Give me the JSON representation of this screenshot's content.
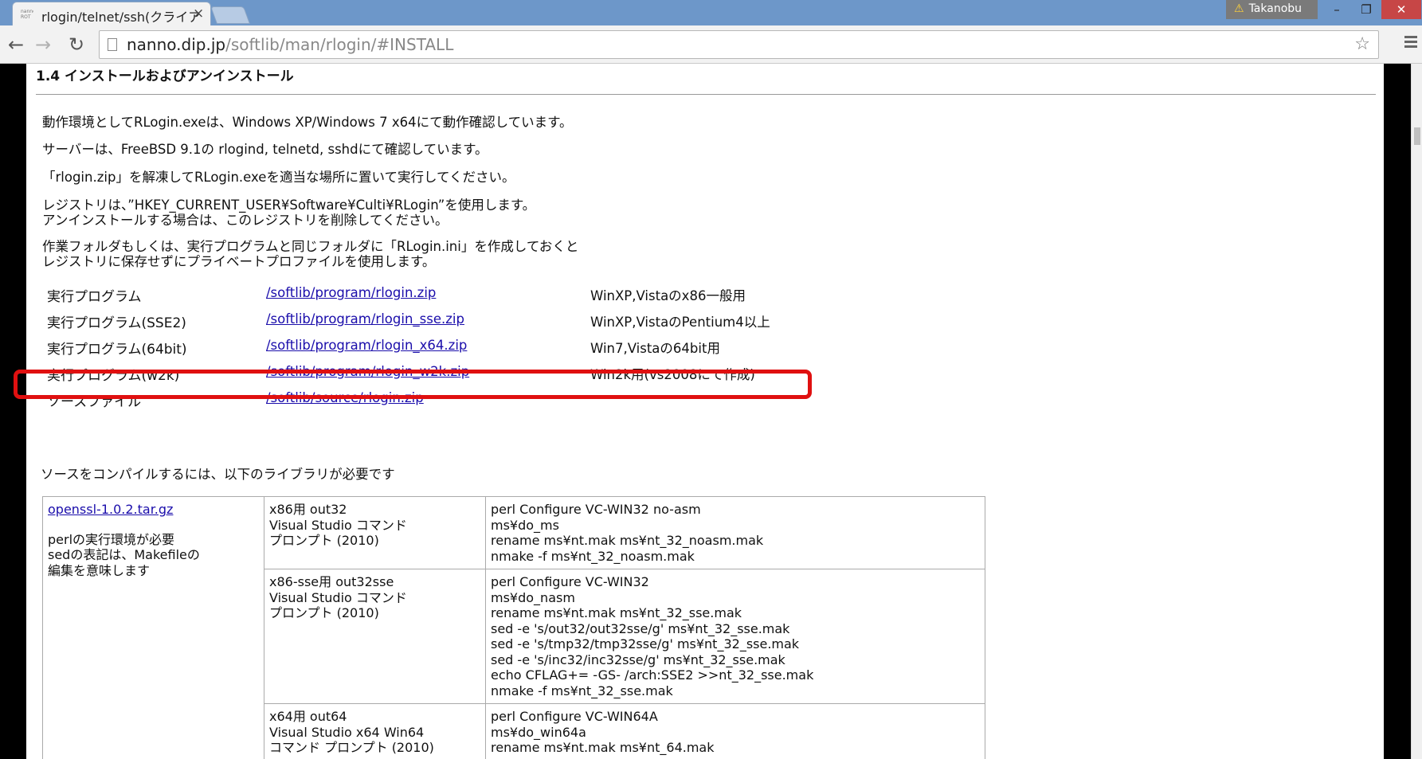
{
  "browser": {
    "tab_title": "rlogin/telnet/ssh(クライア",
    "tab_favicon": "nanno ROT",
    "tab_close": "×",
    "profile_name": "Takanobu",
    "url_host": "nanno.dip.jp",
    "url_path": "/softlib/man/rlogin/#INSTALL",
    "back": "←",
    "forward": "→",
    "reload": "↻",
    "star": "☆",
    "win_min": "–",
    "win_max": "❐",
    "win_close": "✕"
  },
  "page": {
    "section_title": "1.4 インストールおよびアンインストール",
    "paragraphs": [
      "動作環境としてRLogin.exeは、Windows XP/Windows 7 x64にて動作確認しています。",
      "サーバーは、FreeBSD 9.1の rlogind, telnetd, sshdにて確認しています。",
      "「rlogin.zip」を解凍してRLogin.exeを適当な場所に置いて実行してください。",
      "レジストリは、”HKEY_CURRENT_USER¥Software¥Culti¥RLogin”を使用します。\nアンインストールする場合は、このレジストリを削除してください。",
      "作業フォルダもしくは、実行プログラムと同じフォルダに「RLogin.ini」を作成しておくと\nレジストリに保存せずにプライベートプロファイルを使用します。"
    ],
    "downloads": [
      {
        "name": "実行プログラム",
        "link": "/softlib/program/rlogin.zip",
        "note": "WinXP,Vistaのx86一般用"
      },
      {
        "name": "実行プログラム(SSE2)",
        "link": "/softlib/program/rlogin_sse.zip",
        "note": "WinXP,VistaのPentium4以上"
      },
      {
        "name": "実行プログラム(64bit)",
        "link": "/softlib/program/rlogin_x64.zip",
        "note": "Win7,Vistaの64bit用"
      },
      {
        "name": "実行プログラム(w2k)",
        "link": "/softlib/program/rlogin_w2k.zip",
        "note": "Win2k用(vs2008にて作成)"
      },
      {
        "name": "ソースファイル",
        "link": "/softlib/source/rlogin.zip",
        "note": ""
      }
    ],
    "compile_note": "ソースをコンパイルするには、以下のライブラリが必要です",
    "lib": {
      "link": "openssl-1.0.2.tar.gz",
      "desc": "perlの実行環境が必要\nsedの表記は、Makefileの\n編集を意味します",
      "rows": [
        {
          "target": "x86用 out32\nVisual Studio コマンド\nプロンプト (2010)",
          "cmds": "perl Configure VC-WIN32 no-asm\nms¥do_ms\nrename ms¥nt.mak ms¥nt_32_noasm.mak\nnmake -f ms¥nt_32_noasm.mak"
        },
        {
          "target": "x86-sse用 out32sse\nVisual Studio コマンド\nプロンプト (2010)",
          "cmds": "perl Configure VC-WIN32\nms¥do_nasm\nrename ms¥nt.mak ms¥nt_32_sse.mak\nsed -e 's/out32/out32sse/g' ms¥nt_32_sse.mak\nsed -e 's/tmp32/tmp32sse/g' ms¥nt_32_sse.mak\nsed -e 's/inc32/inc32sse/g' ms¥nt_32_sse.mak\necho CFLAG+= -GS- /arch:SSE2 >>nt_32_sse.mak\nnmake -f ms¥nt_32_sse.mak"
        },
        {
          "target": "x64用 out64\nVisual Studio x64 Win64\nコマンド プロンプト (2010)",
          "cmds": "perl Configure VC-WIN64A\nms¥do_win64a\nrename ms¥nt.mak ms¥nt_64.mak"
        }
      ]
    }
  }
}
